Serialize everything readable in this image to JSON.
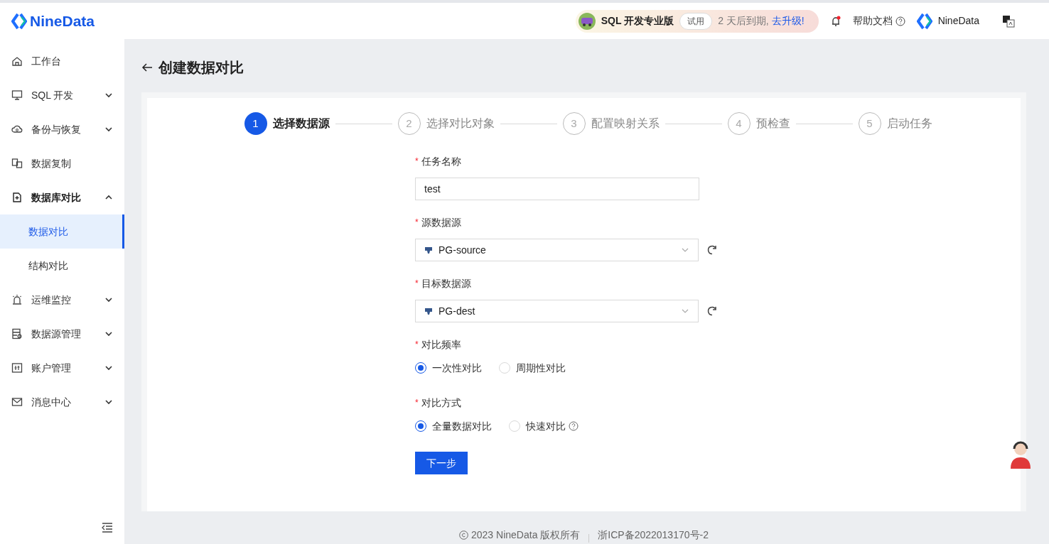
{
  "header": {
    "brand": "NineData",
    "plan": {
      "name": "SQL 开发专业版",
      "badge": "试用",
      "notice": "2 天后到期,",
      "link": "去升级!"
    },
    "notification_unread": true,
    "help": "帮助文档",
    "org": "NineData"
  },
  "sidebar": {
    "items": [
      {
        "label": "工作台"
      },
      {
        "label": "SQL 开发",
        "expanded": false
      },
      {
        "label": "备份与恢复",
        "expanded": false
      },
      {
        "label": "数据复制"
      },
      {
        "label": "数据库对比",
        "expanded": true,
        "children": [
          {
            "label": "数据对比",
            "selected": true
          },
          {
            "label": "结构对比",
            "selected": false
          }
        ]
      },
      {
        "label": "运维监控",
        "expanded": false
      },
      {
        "label": "数据源管理",
        "expanded": false
      },
      {
        "label": "账户管理",
        "expanded": false
      },
      {
        "label": "消息中心",
        "expanded": false
      }
    ]
  },
  "page": {
    "title": "创建数据对比",
    "steps": [
      {
        "number": "1",
        "label": "选择数据源",
        "selected": true
      },
      {
        "number": "2",
        "label": "选择对比对象",
        "selected": false
      },
      {
        "number": "3",
        "label": "配置映射关系",
        "selected": false
      },
      {
        "number": "4",
        "label": "预检查",
        "selected": false
      },
      {
        "number": "5",
        "label": "启动任务",
        "selected": false
      }
    ],
    "fields": [
      {
        "kind": "text",
        "label": "任务名称",
        "required_mark": "*",
        "value": "test"
      },
      {
        "kind": "select",
        "label": "源数据源",
        "required_mark": "*",
        "value": "PG-source"
      },
      {
        "kind": "select",
        "label": "目标数据源",
        "required_mark": "*",
        "value": "PG-dest"
      },
      {
        "kind": "radio",
        "label": "对比频率",
        "required_mark": "*",
        "options": [
          {
            "label": "一次性对比",
            "selected": true
          },
          {
            "label": "周期性对比",
            "selected": false
          }
        ]
      },
      {
        "kind": "radio",
        "label": "对比方式",
        "required_mark": "*",
        "options": [
          {
            "label": "全量数据对比",
            "selected": true
          },
          {
            "label": "快速对比",
            "selected": false,
            "help": true
          }
        ]
      }
    ],
    "next_button": "下一步"
  },
  "footer": {
    "copyright": "2023 NineData 版权所有",
    "icp": "浙ICP备2022013170号-2"
  }
}
